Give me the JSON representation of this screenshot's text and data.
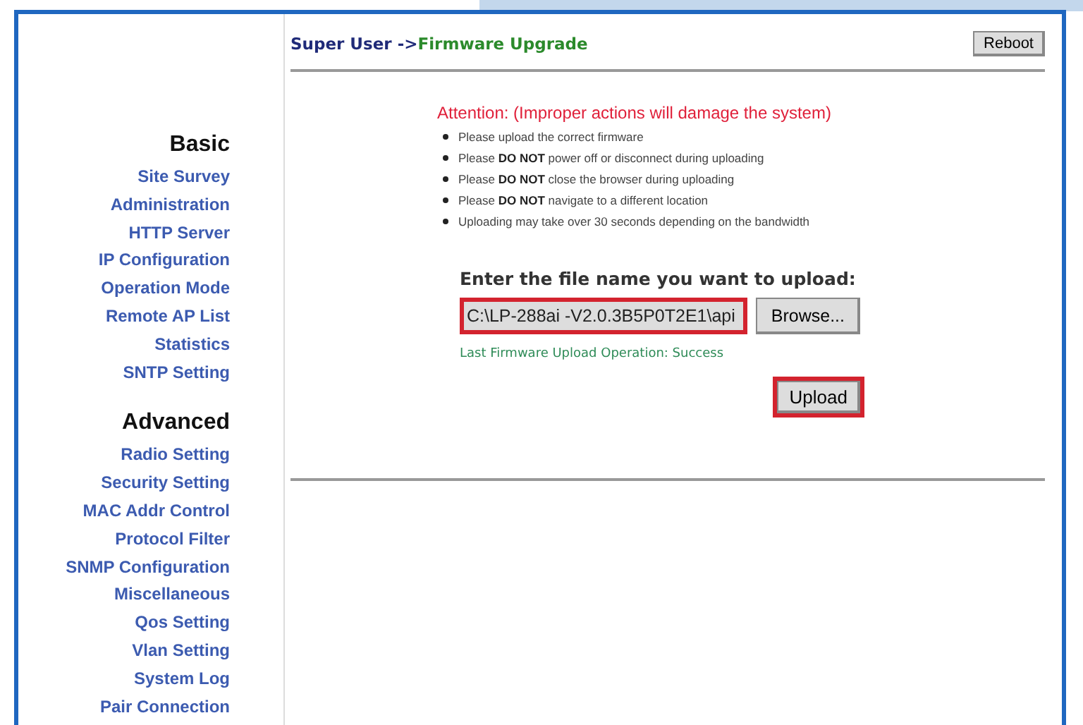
{
  "breadcrumb": {
    "path": "Super User ->",
    "page": "Firmware Upgrade"
  },
  "reboot_button": "Reboot",
  "sidebar": [
    {
      "heading": "Basic",
      "items": [
        "Site Survey",
        "Administration",
        "HTTP Server",
        "IP Configuration",
        "Operation Mode",
        "Remote AP List",
        "Statistics",
        "SNTP Setting"
      ]
    },
    {
      "heading": "Advanced",
      "items": [
        "Radio Setting",
        "Security Setting",
        "MAC Addr Control",
        "Protocol Filter",
        "SNMP Configuration",
        "Miscellaneous",
        "Qos Setting",
        "Vlan Setting",
        "System Log",
        "Pair Connection"
      ]
    }
  ],
  "attention": "Attention: (Improper actions will damage the system)",
  "notes": [
    "Please upload the correct firmware",
    "Please **DO NOT** power off or disconnect during uploading",
    "Please **DO NOT** close the browser during uploading",
    "Please **DO NOT** navigate to a different location",
    "Uploading may take over 30 seconds depending on the bandwidth"
  ],
  "upload": {
    "label": "Enter the file name you want to upload:",
    "file_value": "C:\\LP-288ai -V2.0.3B5P0T2E1\\api",
    "browse_button": "Browse...",
    "last_status": "Last Firmware Upload Operation: Success",
    "upload_button": "Upload"
  }
}
